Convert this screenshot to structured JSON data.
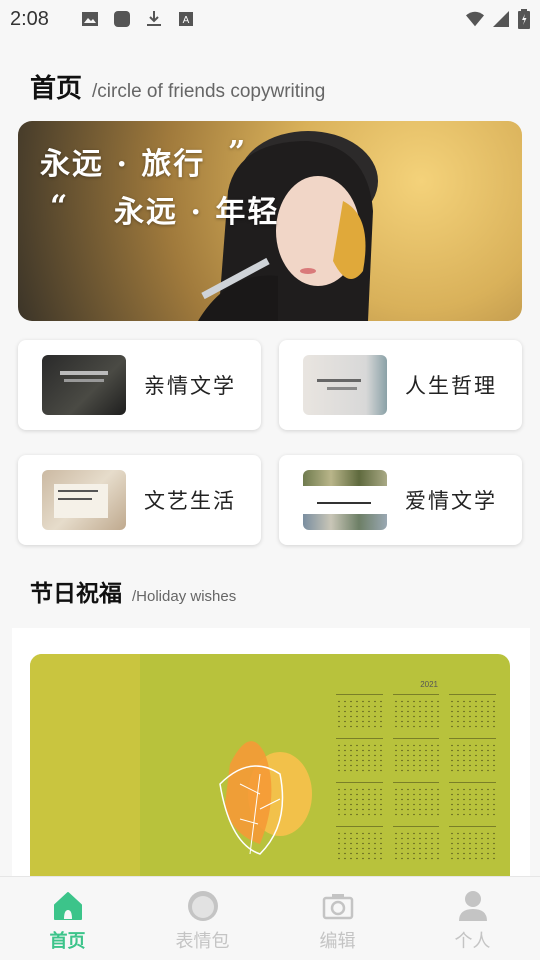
{
  "status_bar": {
    "time": "2:08",
    "icons": [
      "image-icon",
      "app-icon",
      "download-icon",
      "font-icon",
      "wifi-icon",
      "signal-icon",
      "battery-icon"
    ]
  },
  "home_section": {
    "title": "首页",
    "subtitle": "/circle of friends copywriting"
  },
  "banner": {
    "line1": "永远 · 旅行",
    "line2": "永远 · 年轻",
    "quote_open": "“",
    "quote_close": "”"
  },
  "categories": [
    {
      "label": "亲情文学",
      "thumb": "dark-photo"
    },
    {
      "label": "人生哲理",
      "thumb": "note-photo"
    },
    {
      "label": "文艺生活",
      "thumb": "paper-photo"
    },
    {
      "label": "爱情文学",
      "thumb": "collage-photo"
    }
  ],
  "holiday_section": {
    "title": "节日祝福",
    "subtitle": "/Holiday wishes",
    "calendar_year": "2021"
  },
  "bottom_nav": [
    {
      "label": "首页",
      "icon": "home-icon",
      "active": true
    },
    {
      "label": "表情包",
      "icon": "emoji-icon",
      "active": false
    },
    {
      "label": "编辑",
      "icon": "camera-icon",
      "active": false
    },
    {
      "label": "个人",
      "icon": "person-icon",
      "active": false
    }
  ],
  "colors": {
    "accent": "#3cc48a",
    "inactive": "#c4c4c4",
    "calendar_bg": "#b8c23c"
  }
}
